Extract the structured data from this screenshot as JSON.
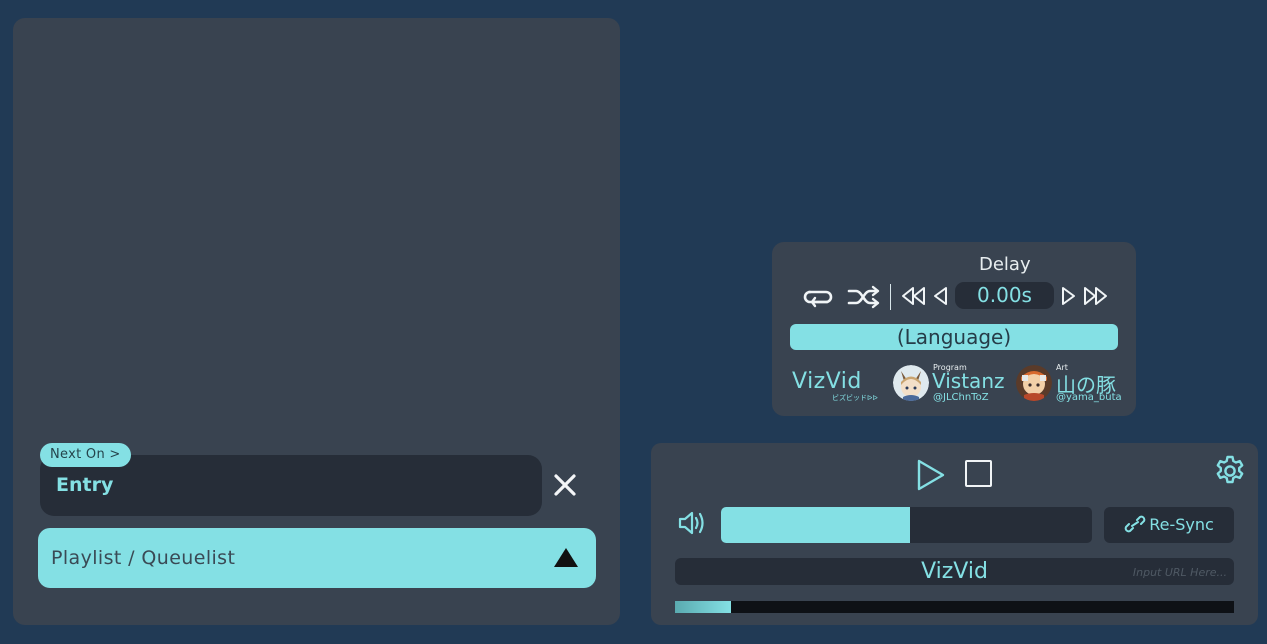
{
  "playlist": {
    "next_on_label": "Next On >",
    "entry_value": "Entry",
    "playlist_label": "Playlist / Queuelist"
  },
  "info": {
    "delay_label": "Delay",
    "delay_value": "0.00s",
    "language_label": "(Language)",
    "credits": {
      "logo": "VizVid",
      "logo_sub": "ビズビッドᐅᐅ",
      "program_role": "Program",
      "program_name": "Vistanz",
      "program_handle": "@JLChnToZ",
      "art_role": "Art",
      "art_name": "山の豚",
      "art_handle": "@yama_buta"
    }
  },
  "player": {
    "volume_level": 0.51,
    "resync_label": "Re-Sync",
    "title": "VizVid",
    "url_placeholder": "Input URL Here...",
    "progress": 0.1
  },
  "colors": {
    "background": "#213a55",
    "panel": "#394350",
    "accent": "#84e0e4",
    "field": "#262d38"
  },
  "icons": [
    "close-icon",
    "collapse-triangle-icon",
    "loop-icon",
    "shuffle-icon",
    "rewind-fast-icon",
    "rewind-icon",
    "forward-icon",
    "forward-fast-icon",
    "play-icon",
    "stop-icon",
    "gear-icon",
    "volume-icon",
    "link-icon"
  ]
}
